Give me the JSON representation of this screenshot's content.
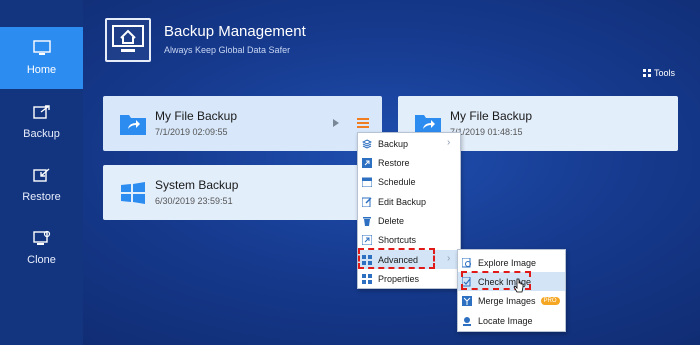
{
  "sidebar": {
    "items": [
      {
        "label": "Home"
      },
      {
        "label": "Backup"
      },
      {
        "label": "Restore"
      },
      {
        "label": "Clone"
      }
    ]
  },
  "header": {
    "title": "Backup Management",
    "subtitle": "Always Keep Global Data Safer",
    "tools_label": "Tools"
  },
  "cards": [
    {
      "title": "My File Backup",
      "date": "7/1/2019 02:09:55"
    },
    {
      "title": "My File Backup",
      "date": "7/1/2019 01:48:15"
    },
    {
      "title": "System Backup",
      "date": "6/30/2019 23:59:51"
    }
  ],
  "context_menu": {
    "items": [
      "Backup",
      "Restore",
      "Schedule",
      "Edit Backup",
      "Delete",
      "Shortcuts",
      "Advanced",
      "Properties"
    ]
  },
  "submenu": {
    "items": [
      "Explore Image",
      "Check Image",
      "Merge Images",
      "Locate Image"
    ],
    "pro_badge": "PRO"
  },
  "colors": {
    "accent": "#2d8cf0",
    "highlight_dash": "#e01919",
    "menu_orange": "#f07d20"
  }
}
